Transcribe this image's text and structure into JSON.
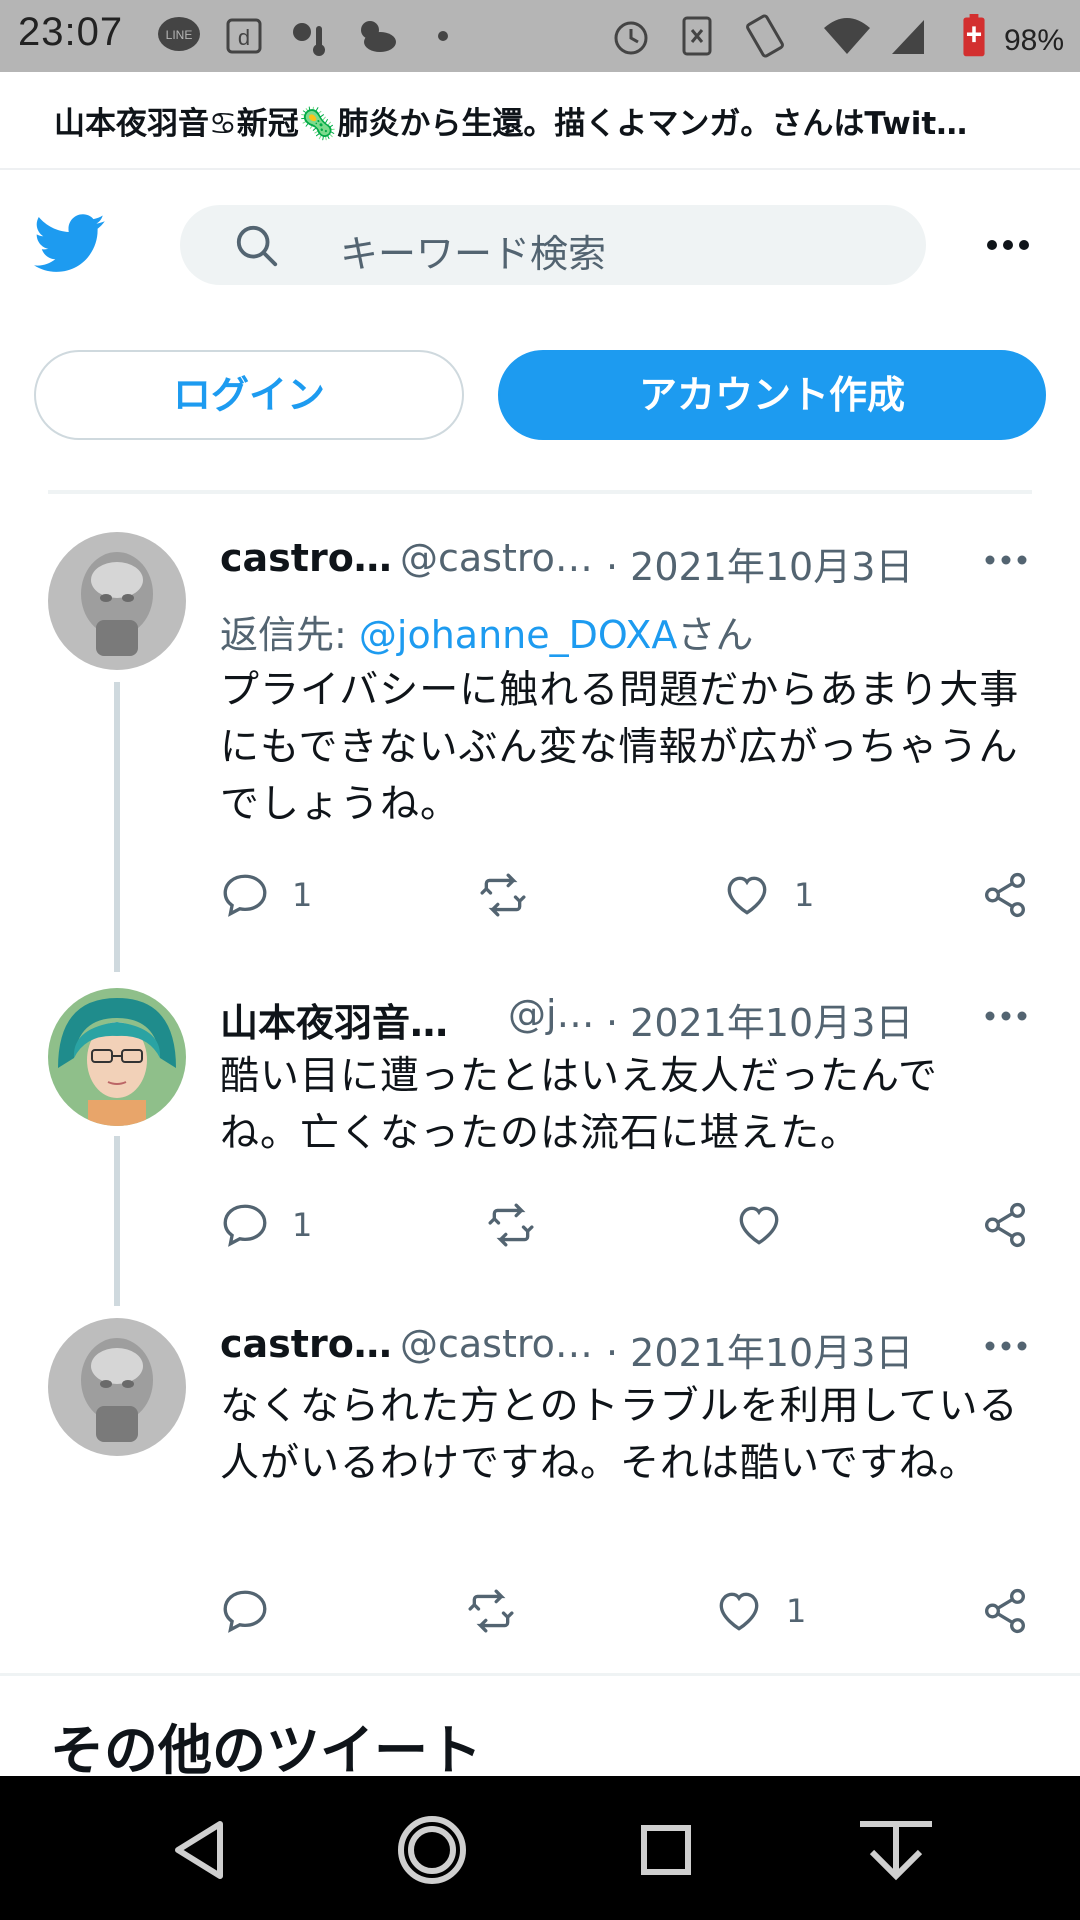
{
  "status_bar": {
    "time": "23:07",
    "battery": "98%",
    "icons": [
      "line-app-icon",
      "d-app-icon",
      "weather-icon",
      "weather-cloud-icon",
      "dot-icon",
      "alarm-icon",
      "nfc-icon",
      "rotate-icon",
      "wifi-icon",
      "signal-icon",
      "battery-icon"
    ]
  },
  "page": {
    "title": "山本夜羽音♋新冠🦠肺炎から生還。描くよマンガ。さんはTwit…"
  },
  "header": {
    "search_placeholder": "キーワード検索",
    "login_label": "ログイン",
    "signup_label": "アカウント作成"
  },
  "colors": {
    "accent": "#1d9bf0",
    "text_secondary": "#536471",
    "thread_line": "#cfd9de"
  },
  "tweets": [
    {
      "name": "castro…",
      "handle": "@castro…",
      "date": "· 2021年10月3日",
      "reply_prefix": "返信先: ",
      "reply_mention": "@johanne_DOXA",
      "reply_suffix": "さん",
      "text": "プライバシーに触れる問題だからあまり大事にもできないぶん変な情報が広がっちゃうんでしょうね。",
      "replies": "1",
      "retweets": "",
      "likes": "1"
    },
    {
      "name": "山本夜羽音…",
      "handle": "@j…",
      "date": "· 2021年10月3日",
      "text": "酷い目に遭ったとはいえ友人だったんでね。亡くなったのは流石に堪えた。",
      "replies": "1",
      "retweets": "",
      "likes": ""
    },
    {
      "name": "castro…",
      "handle": "@castro…",
      "date": "· 2021年10月3日",
      "text": "なくなられた方とのトラブルを利用している人がいるわけですね。それは酷いですね。",
      "replies": "",
      "retweets": "",
      "likes": "1"
    }
  ],
  "section": {
    "more_tweets_title": "その他のツイート"
  },
  "nav": {
    "buttons": [
      "back-icon",
      "home-icon",
      "recents-icon",
      "download-icon"
    ]
  }
}
